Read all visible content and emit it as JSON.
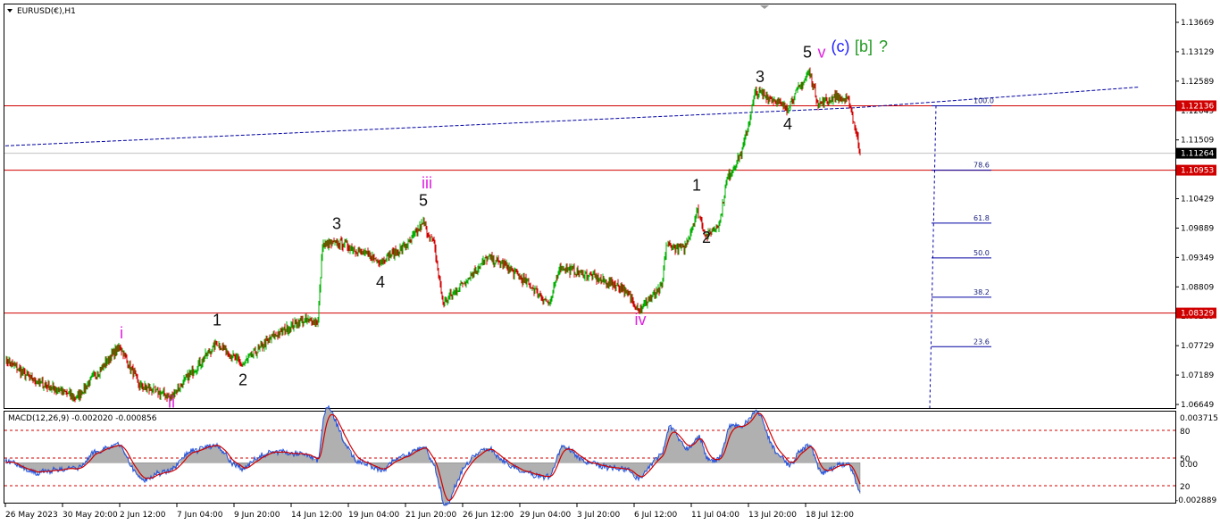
{
  "symbol": {
    "title": "EURUSD(€),H1",
    "menu_icon": "triangle-down-icon"
  },
  "macd": {
    "title": "MACD(12,26,9) -0.002020 -0.000856",
    "levels": [
      "0.003715",
      "80",
      "50",
      "0.00",
      "20",
      "-0.002889"
    ]
  },
  "colors": {
    "bull": "#00b000",
    "bear": "#d00000",
    "ma": "#0000a0",
    "hline": "#d00000",
    "magenta": "#e020e0",
    "blue": "#2020ff",
    "green": "#229922",
    "macd_line": "#2050e0",
    "signal": "#d00000",
    "hist": "#b0b0b0"
  },
  "chart_data": {
    "type": "candlestick",
    "title": "EURUSD(€),H1",
    "xlabel": "",
    "ylabel": "",
    "ylim": [
      1.06649,
      1.13669
    ],
    "grid": false,
    "price_ticks": [
      "1.13669",
      "1.13129",
      "1.12589",
      "1.12049",
      "1.11509",
      "1.10429",
      "1.09889",
      "1.09349",
      "1.08809",
      "1.08269",
      "1.07729",
      "1.07189",
      "1.06649"
    ],
    "price_tick_values": [
      1.13669,
      1.13129,
      1.12589,
      1.12049,
      1.11509,
      1.10429,
      1.09889,
      1.09349,
      1.08809,
      1.08269,
      1.07729,
      1.07189,
      1.06649
    ],
    "price_marks": [
      {
        "text": "1.12136",
        "value": 1.12136,
        "color": "#d00000"
      },
      {
        "text": "1.11264",
        "value": 1.11264,
        "color": "#000000"
      },
      {
        "text": "1.10953",
        "value": 1.10953,
        "color": "#d00000"
      },
      {
        "text": "1.08329",
        "value": 1.08329,
        "color": "#d00000"
      }
    ],
    "hlines": [
      1.12136,
      1.10953,
      1.08329
    ],
    "time_labels": [
      "26 May 2023",
      "30 May 20:00",
      "2 Jun 12:00",
      "7 Jun 04:00",
      "9 Jun 20:00",
      "14 Jun 12:00",
      "19 Jun 04:00",
      "21 Jun 20:00",
      "26 Jun 12:00",
      "29 Jun 04:00",
      "3 Jul 20:00",
      "6 Jul 12:00",
      "11 Jul 04:00",
      "13 Jul 20:00",
      "18 Jul 12:00"
    ],
    "time_label_bars": [
      0,
      64,
      128,
      192,
      256,
      320,
      384,
      448,
      512,
      576,
      640,
      704,
      768,
      832,
      896
    ],
    "bars": 952,
    "price_path": [
      [
        0,
        1.0748
      ],
      [
        30,
        1.071
      ],
      [
        80,
        1.0678
      ],
      [
        128,
        1.0772
      ],
      [
        150,
        1.07
      ],
      [
        185,
        1.0678
      ],
      [
        237,
        1.0778
      ],
      [
        265,
        1.0738
      ],
      [
        300,
        1.079
      ],
      [
        330,
        1.0818
      ],
      [
        350,
        1.0818
      ],
      [
        355,
        1.0958
      ],
      [
        375,
        1.0962
      ],
      [
        420,
        1.0928
      ],
      [
        450,
        1.0958
      ],
      [
        468,
        1.0998
      ],
      [
        480,
        1.0958
      ],
      [
        490,
        1.085
      ],
      [
        540,
        1.0935
      ],
      [
        560,
        1.092
      ],
      [
        590,
        1.088
      ],
      [
        610,
        1.0848
      ],
      [
        620,
        1.0918
      ],
      [
        660,
        1.0898
      ],
      [
        690,
        1.088
      ],
      [
        710,
        1.084
      ],
      [
        735,
        1.088
      ],
      [
        740,
        1.0958
      ],
      [
        760,
        1.095
      ],
      [
        775,
        1.102
      ],
      [
        785,
        1.0972
      ],
      [
        800,
        1.1
      ],
      [
        808,
        1.108
      ],
      [
        825,
        1.113
      ],
      [
        840,
        1.124
      ],
      [
        860,
        1.1226
      ],
      [
        875,
        1.121
      ],
      [
        900,
        1.1276
      ],
      [
        910,
        1.1218
      ],
      [
        930,
        1.123
      ],
      [
        945,
        1.122
      ],
      [
        957,
        1.113
      ]
    ],
    "ma_line": [
      [
        0,
        1.114
      ],
      [
        952,
        1.121
      ],
      [
        1270,
        1.1248
      ]
    ],
    "fib": {
      "levels": [
        {
          "label": "100.0",
          "value": 1.12136
        },
        {
          "label": "78.6",
          "value": 1.10953
        },
        {
          "label": "61.8",
          "value": 1.0998
        },
        {
          "label": "50.0",
          "value": 1.0934
        },
        {
          "label": "38.2",
          "value": 1.0862
        },
        {
          "label": "23.6",
          "value": 1.0771
        }
      ]
    },
    "wave_labels": [
      {
        "text": "i",
        "bar": 130,
        "price": 1.0786,
        "color": "#e020e0"
      },
      {
        "text": "ii",
        "bar": 186,
        "price": 1.0659,
        "color": "#e020e0"
      },
      {
        "text": "1",
        "bar": 237,
        "price": 1.081,
        "color": "#111111"
      },
      {
        "text": "2",
        "bar": 266,
        "price": 1.07,
        "color": "#111111"
      },
      {
        "text": "3",
        "bar": 371,
        "price": 1.0987,
        "color": "#111111"
      },
      {
        "text": "4",
        "bar": 420,
        "price": 1.088,
        "color": "#111111"
      },
      {
        "text": "iii",
        "bar": 472,
        "price": 1.1062,
        "color": "#e020e0"
      },
      {
        "text": "5",
        "bar": 468,
        "price": 1.103,
        "color": "#111111"
      },
      {
        "text": "iv",
        "bar": 711,
        "price": 1.0811,
        "color": "#e020e0"
      },
      {
        "text": "1",
        "bar": 774,
        "price": 1.1058,
        "color": "#111111"
      },
      {
        "text": "2",
        "bar": 785,
        "price": 1.0962,
        "color": "#111111"
      },
      {
        "text": "3",
        "bar": 845,
        "price": 1.1257,
        "color": "#111111"
      },
      {
        "text": "4",
        "bar": 876,
        "price": 1.117,
        "color": "#111111"
      },
      {
        "text": "5",
        "bar": 898,
        "price": 1.1302,
        "color": "#111111"
      },
      {
        "text": "v",
        "bar": 914,
        "price": 1.1302,
        "color": "#e020e0"
      },
      {
        "text": "(c)",
        "bar": 935,
        "price": 1.1313,
        "color": "#2020ff"
      },
      {
        "text": "[b]",
        "bar": 961,
        "price": 1.1313,
        "color": "#229922"
      },
      {
        "text": "?",
        "bar": 983,
        "price": 1.1313,
        "color": "#229922"
      }
    ]
  }
}
